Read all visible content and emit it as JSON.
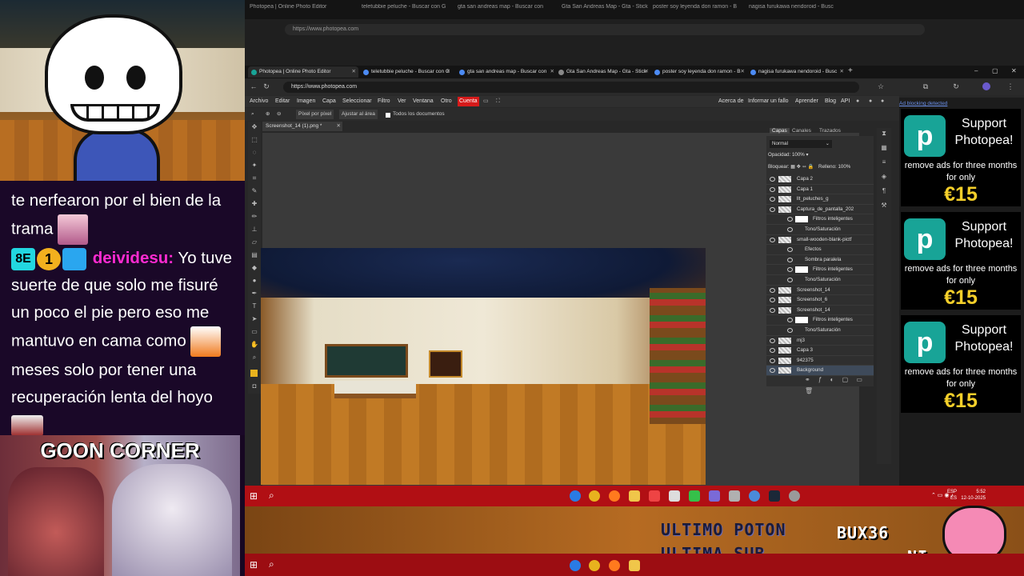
{
  "chat": {
    "line1": "te nerfearon por el bien de la",
    "line2": "trama",
    "badges_text": "8E",
    "badge_num": "1",
    "username": "deividesu:",
    "msg1": "Yo tuve",
    "msg2": "suerte de que solo me fisuré",
    "msg3": "un poco el pie pero eso me",
    "msg4": "mantuvo en cama como",
    "msg5": "meses solo por tener una",
    "msg6": "recuperación lenta del hoyo"
  },
  "goon_title": "GOON CORNER",
  "browser": {
    "tabs": [
      {
        "label": "Photopea | Online Photo Editor",
        "color": "#18a497"
      },
      {
        "label": "teletubbie peluche - Buscar con G",
        "color": "#4c8bf5"
      },
      {
        "label": "gta san andreas map - Buscar con",
        "color": "#4c8bf5"
      },
      {
        "label": "Gta San Andreas Map - Gta - Stick",
        "color": "#888888"
      },
      {
        "label": "poster soy leyenda don ramon - B",
        "color": "#4c8bf5"
      },
      {
        "label": "nagisa furukawa nendoroid - Busc",
        "color": "#4c8bf5"
      }
    ],
    "url": "https://www.photopea.com"
  },
  "menu": {
    "items": [
      "Archivo",
      "Editar",
      "Imagen",
      "Capa",
      "Seleccionar",
      "Filtro",
      "Ver",
      "Ventana",
      "Otro",
      "Cuenta"
    ],
    "right": [
      "Acerca de",
      "Informar un fallo",
      "Aprender",
      "Blog",
      "API"
    ]
  },
  "options": {
    "pixel": "Píxel por píxel",
    "fit": "Ajustar al área",
    "all_docs": "Todos los documentos"
  },
  "doc_tab": "Screenshot_14 (1).png *",
  "panel": {
    "tabs": [
      "Capas",
      "Canales",
      "Trazados"
    ],
    "blend": "Normal",
    "opacity_label": "Opacidad:",
    "opacity": "100%",
    "lock_label": "Bloquear:",
    "fill_label": "Relleno:",
    "fill": "100%",
    "layers": [
      {
        "name": "Capa 2",
        "kind": "main"
      },
      {
        "name": "Capa 1",
        "kind": "main"
      },
      {
        "name": "llt_peluches_g",
        "kind": "main"
      },
      {
        "name": "Captura_de_pantalla_202",
        "kind": "main"
      },
      {
        "name": "Filtros inteligentes",
        "kind": "sub"
      },
      {
        "name": "Tono/Saturación",
        "kind": "tiny"
      },
      {
        "name": "small-wooden-blank-pictf",
        "kind": "main"
      },
      {
        "name": "Efectos",
        "kind": "tiny"
      },
      {
        "name": "Sombra paralela",
        "kind": "tiny"
      },
      {
        "name": "Filtros inteligentes",
        "kind": "sub"
      },
      {
        "name": "Tono/Saturación",
        "kind": "tiny"
      },
      {
        "name": "Screenshot_14",
        "kind": "main"
      },
      {
        "name": "Screenshot_6",
        "kind": "main"
      },
      {
        "name": "Screenshot_14",
        "kind": "main"
      },
      {
        "name": "Filtros inteligentes",
        "kind": "sub"
      },
      {
        "name": "Tono/Saturación",
        "kind": "tiny"
      },
      {
        "name": "mj3",
        "kind": "main"
      },
      {
        "name": "Capa 3",
        "kind": "main"
      },
      {
        "name": "942375",
        "kind": "main"
      },
      {
        "name": "Background",
        "kind": "sel"
      }
    ]
  },
  "ads": {
    "blocking": "Ad blocking detected",
    "support": "Support Photopea!",
    "remove": "remove ads for three months for only",
    "price": "€15",
    "logo": "p"
  },
  "taskbar": {
    "lang": "ESP",
    "lang2": "ES",
    "time": "5:52",
    "date": "12-10-2025"
  },
  "overlay": {
    "ultimo_poton": "ULTIMO POTON",
    "ultima_sub": "ULTIMA SUB",
    "name": "BUX36",
    "name2": "NI"
  }
}
